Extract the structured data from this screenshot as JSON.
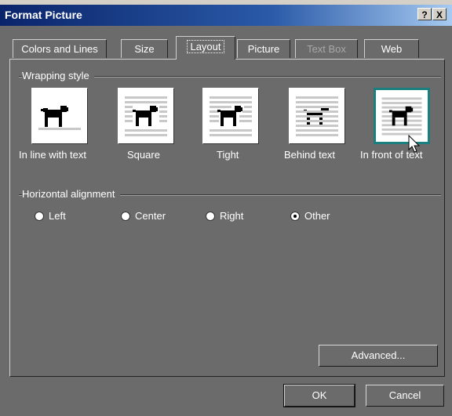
{
  "window": {
    "title": "Format Picture",
    "help_label": "?",
    "close_label": "X"
  },
  "tabs": [
    {
      "label": "Colors and Lines",
      "state": "normal"
    },
    {
      "label": "Size",
      "state": "normal"
    },
    {
      "label": "Layout",
      "state": "active"
    },
    {
      "label": "Picture",
      "state": "normal"
    },
    {
      "label": "Text Box",
      "state": "disabled"
    },
    {
      "label": "Web",
      "state": "normal"
    }
  ],
  "wrapping": {
    "heading": "Wrapping style",
    "options": [
      {
        "label": "In line with text",
        "icon": "wrap-inline-icon",
        "selected": false
      },
      {
        "label": "Square",
        "icon": "wrap-square-icon",
        "selected": false
      },
      {
        "label": "Tight",
        "icon": "wrap-tight-icon",
        "selected": false
      },
      {
        "label": "Behind text",
        "icon": "wrap-behind-icon",
        "selected": false
      },
      {
        "label": "In front of text",
        "icon": "wrap-front-icon",
        "selected": true
      }
    ]
  },
  "alignment": {
    "heading": "Horizontal alignment",
    "options": [
      {
        "label": "Left",
        "checked": false
      },
      {
        "label": "Center",
        "checked": false
      },
      {
        "label": "Right",
        "checked": false
      },
      {
        "label": "Other",
        "checked": true
      }
    ]
  },
  "buttons": {
    "advanced": "Advanced...",
    "ok": "OK",
    "cancel": "Cancel"
  },
  "colors": {
    "dialog_bg": "#6b6b6b",
    "titlebar_start": "#0a246a",
    "selection_border": "#1a7f7f"
  }
}
